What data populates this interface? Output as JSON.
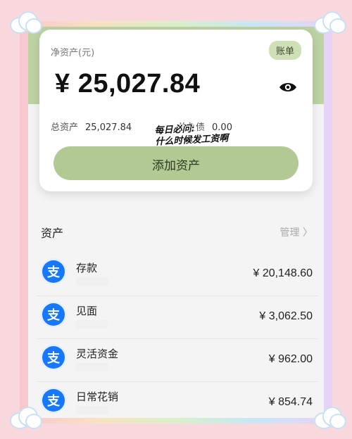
{
  "summary": {
    "net_label": "净资产(元)",
    "bill_label": "账单",
    "amount": "¥ 25,027.84",
    "total_assets_label": "总资产",
    "total_assets_value": "25,027.84",
    "total_liabilities_label": "总负债",
    "total_liabilities_value": "0.00",
    "add_asset_label": "添加资产",
    "overlay_line1": "每日必问:",
    "overlay_line2": "什么时候发工资啊"
  },
  "assets": {
    "title": "资产",
    "manage_label": "管理 〉",
    "items": [
      {
        "name": "存款",
        "value": "¥ 20,148.60",
        "icon": "alipay-icon"
      },
      {
        "name": "见面",
        "value": "¥ 3,062.50",
        "icon": "alipay-icon"
      },
      {
        "name": "灵活资金",
        "value": "¥ 962.00",
        "icon": "alipay-icon"
      },
      {
        "name": "日常花销",
        "value": "¥ 854.74",
        "icon": "alipay-icon"
      }
    ]
  },
  "icon_glyph": "支",
  "colors": {
    "accent_green": "#b2c993",
    "alipay_blue": "#1677ff",
    "background_pink": "#f9d8dd"
  }
}
